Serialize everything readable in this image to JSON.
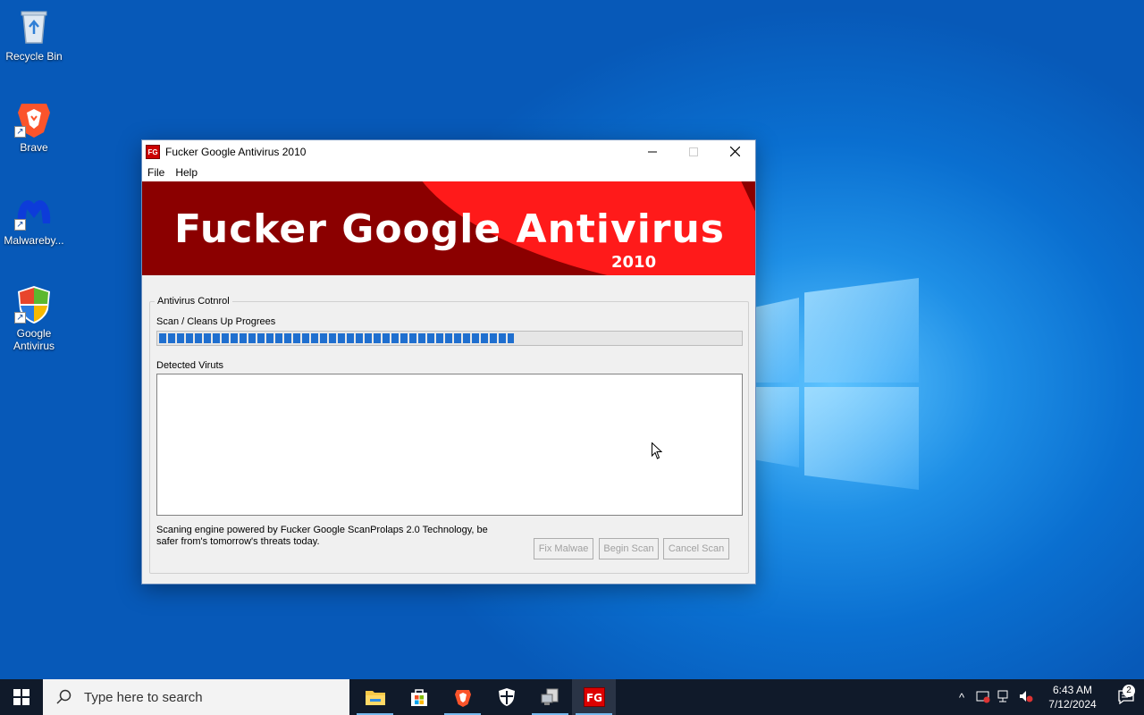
{
  "desktop": {
    "icons": [
      {
        "label": "Recycle Bin",
        "icon": "recycle-bin-icon"
      },
      {
        "label": "Brave",
        "icon": "brave-icon"
      },
      {
        "label": "Malwareby...",
        "icon": "malwarebytes-icon"
      },
      {
        "label": "Google Antivirus",
        "icon": "google-antivirus-icon"
      }
    ]
  },
  "window": {
    "app_icon_text": "FG",
    "title": "Fucker Google Antivirus 2010",
    "menu": [
      "File",
      "Help"
    ],
    "banner_title": "Fucker Google Antivirus",
    "banner_year": "2010",
    "group_label": "Antivirus Cotnrol",
    "progress_label": "Scan / Cleans Up Progrees",
    "progress_fraction": 0.61,
    "detected_label": "Detected Viruts",
    "footer_text": "Scaning engine powered by Fucker Google ScanProlaps 2.0 Technology, be safer from's tomorrow's threats today.",
    "buttons": {
      "fix": "Fix Malwae",
      "begin": "Begin Scan",
      "cancel": "Cancel Scan"
    }
  },
  "taskbar": {
    "search_placeholder": "Type here to search",
    "pinned": [
      "file-explorer-icon",
      "microsoft-store-icon",
      "brave-icon",
      "security-shield-icon",
      "network-computer-icon",
      "fg-antivirus-icon"
    ],
    "clock_time": "6:43 AM",
    "clock_date": "7/12/2024",
    "notification_count": "2"
  },
  "colors": {
    "banner_dark": "#8b0000",
    "banner_bright": "#ff1a1a",
    "progress": "#1f6fcf",
    "taskbar": "#101a2a"
  }
}
